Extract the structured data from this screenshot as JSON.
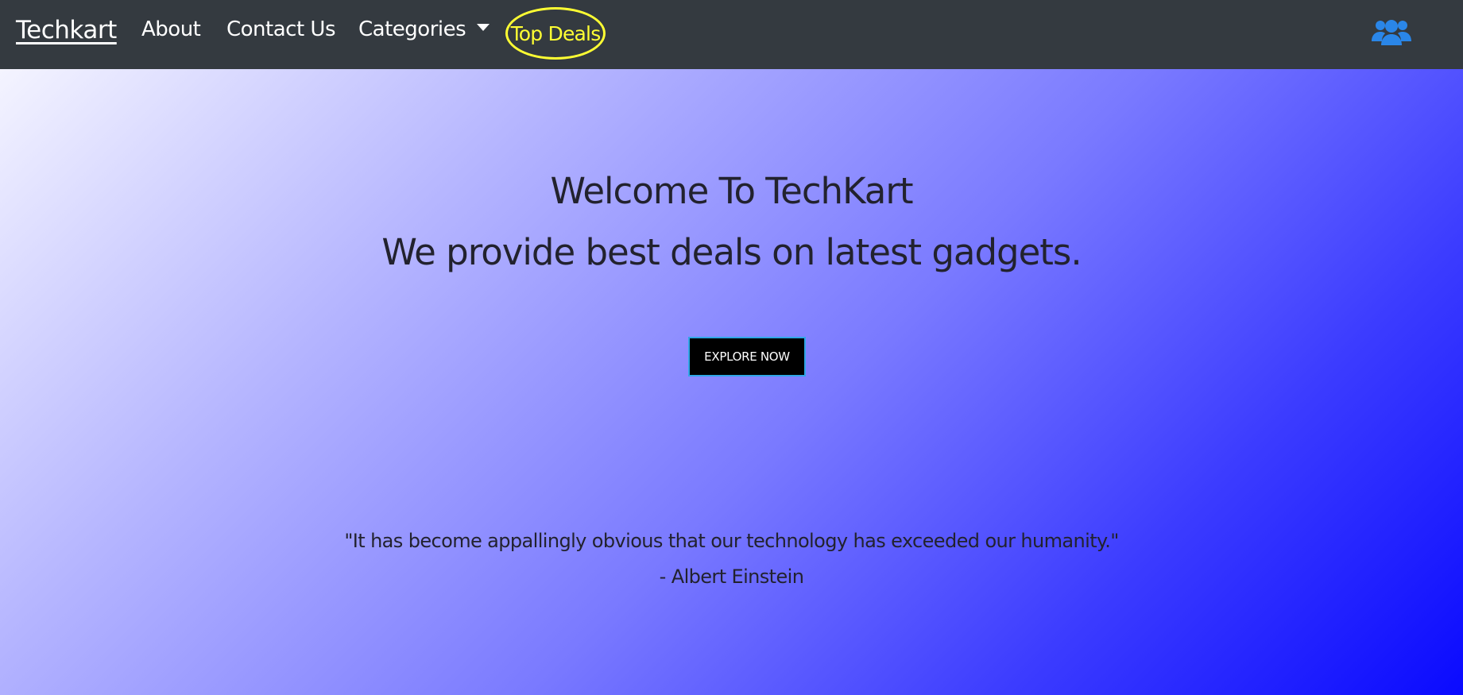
{
  "navbar": {
    "brand": "Techkart",
    "links": {
      "about": "About",
      "contact": "Contact Us",
      "categories": "Categories",
      "top_deals": "Top Deals"
    },
    "user_icon": "users-icon",
    "colors": {
      "background": "#343a40",
      "link": "#ffffff",
      "highlight": "#ffff33",
      "icon": "#2a86e8"
    }
  },
  "hero": {
    "title": "Welcome To TechKart",
    "subtitle": "We provide best deals on latest gadgets.",
    "cta_label": "EXPLORE NOW",
    "quote": "\"It has become appallingly obvious that our technology has exceeded our humanity.\"",
    "quote_author": "- Albert Einstein",
    "colors": {
      "gradient_start": "#f4f4ff",
      "gradient_end": "#0a0aff",
      "text": "#22222e",
      "button_bg": "#000000",
      "button_border": "#2fa6e6"
    }
  }
}
